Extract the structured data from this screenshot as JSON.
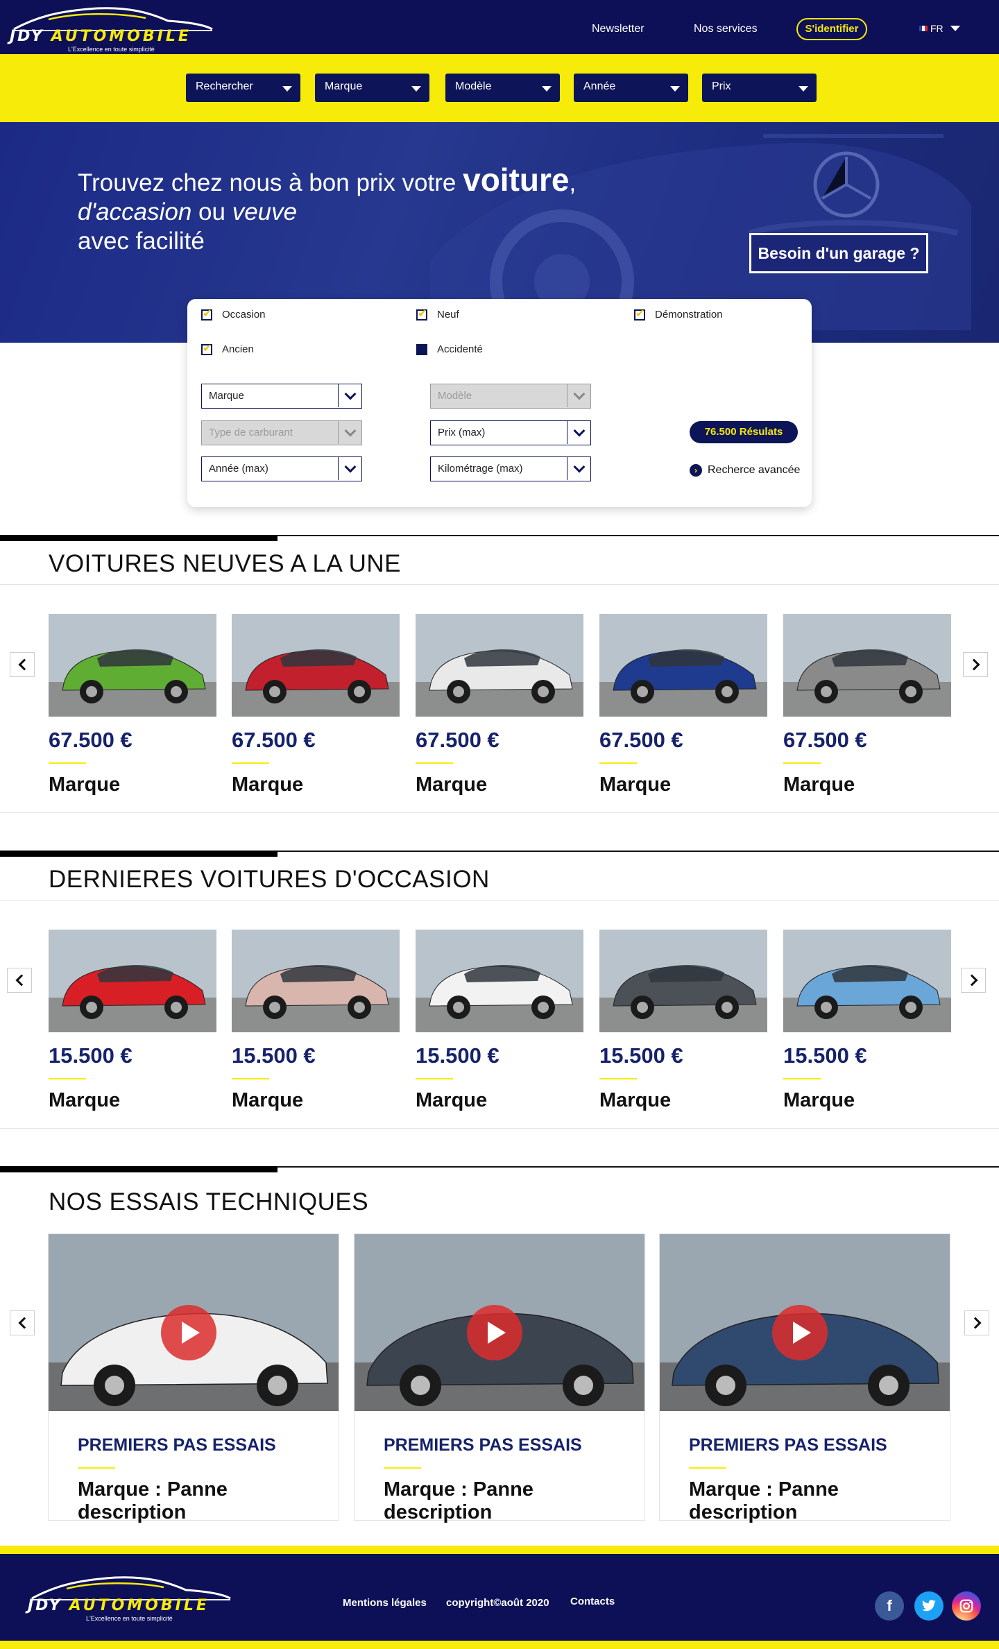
{
  "header": {
    "logo_word1": "JDY",
    "logo_word2": "AUTOMOBILE",
    "logo_tagline": "L'Excellence en toute simplicité",
    "nav": [
      "Newsletter",
      "Nos services"
    ],
    "login": "S'identifier",
    "lang": "FR"
  },
  "filterbar": [
    "Rechercher",
    "Marque",
    "Modèle",
    "Année",
    "Prix"
  ],
  "hero": {
    "line1": "Trouvez chez nous à bon prix votre ",
    "line1_bold": "voiture",
    "line1_end": ",",
    "line2_a": "d'accasion",
    "line2_b": " ou ",
    "line2_c": "veuve",
    "line3": "avec facilité",
    "garage_button": "Besoin d'un garage ?"
  },
  "search": {
    "checkboxes": [
      {
        "label": "Occasion",
        "state": "checked"
      },
      {
        "label": "Neuf",
        "state": "checked"
      },
      {
        "label": "Démonstration",
        "state": "checked"
      },
      {
        "label": "Ancien",
        "state": "checked"
      },
      {
        "label": "Accidenté",
        "state": "filled"
      }
    ],
    "dropdowns": [
      {
        "label": "Marque",
        "disabled": false
      },
      {
        "label": "Modèle",
        "disabled": true
      },
      {
        "label": "Type de carburant",
        "disabled": true
      },
      {
        "label": "Prix (max)",
        "disabled": false
      },
      {
        "label": "Année (max)",
        "disabled": false
      },
      {
        "label": "Kilométrage (max)",
        "disabled": false
      }
    ],
    "results": "76.500 Résulats",
    "advanced": "Recherce avancée"
  },
  "new_cars": {
    "title": "VOITURES  NEUVES A LA UNE",
    "cards": [
      {
        "price": "67.500 €",
        "brand": "Marque",
        "color": "#5fae33"
      },
      {
        "price": "67.500 €",
        "brand": "Marque",
        "color": "#c2202c"
      },
      {
        "price": "67.500 €",
        "brand": "Marque",
        "color": "#e9e9e9"
      },
      {
        "price": "67.500 €",
        "brand": "Marque",
        "color": "#1f3b8f"
      },
      {
        "price": "67.500 €",
        "brand": "Marque",
        "color": "#8a8a8a"
      }
    ]
  },
  "used_cars": {
    "title": "DERNIERES VOITURES  D'OCCASION",
    "cards": [
      {
        "price": "15.500 €",
        "brand": "Marque",
        "color": "#d81f26"
      },
      {
        "price": "15.500 €",
        "brand": "Marque",
        "color": "#d8b6ae"
      },
      {
        "price": "15.500 €",
        "brand": "Marque",
        "color": "#f2f2f2"
      },
      {
        "price": "15.500 €",
        "brand": "Marque",
        "color": "#4b5156"
      },
      {
        "price": "15.500 €",
        "brand": "Marque",
        "color": "#6aa7d8"
      }
    ]
  },
  "tests": {
    "title": "NOS ESSAIS TECHNIQUES",
    "cards": [
      {
        "kicker": "PREMIERS PAS ESSAIS",
        "desc": "Marque : Panne description",
        "color": "#f0f0f0"
      },
      {
        "kicker": "PREMIERS PAS ESSAIS",
        "desc": "Marque : Panne description",
        "color": "#3c4450"
      },
      {
        "kicker": "PREMIERS PAS ESSAIS",
        "desc": "Marque : Panne description",
        "color": "#2f4a6e"
      }
    ]
  },
  "footer": {
    "links": [
      "Mentions légales",
      "copyright©août 2020",
      "Contacts"
    ],
    "social": [
      "facebook-icon",
      "twitter-icon",
      "instagram-icon"
    ]
  },
  "colors": {
    "navy": "#0d0f57",
    "yellow": "#f7eb0a",
    "price": "#16226b"
  }
}
